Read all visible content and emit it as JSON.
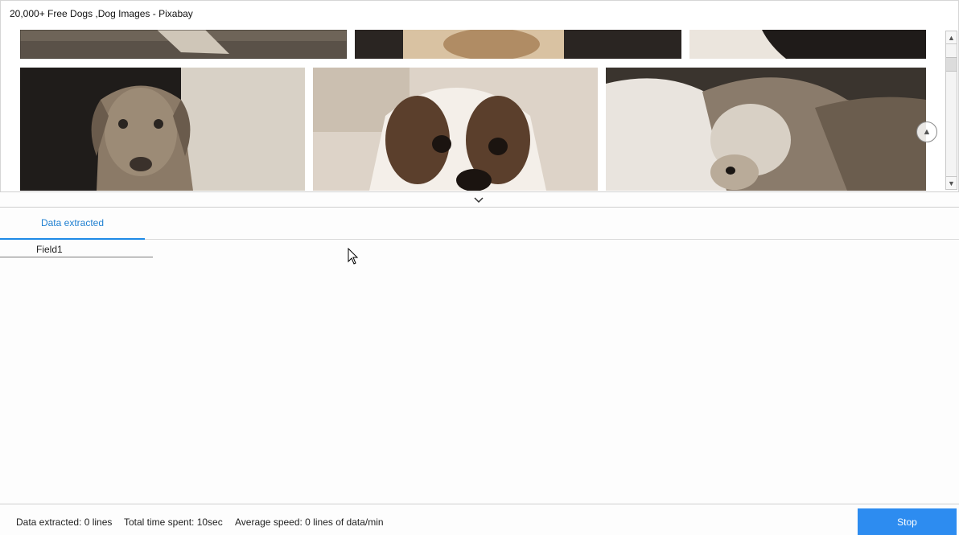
{
  "page": {
    "title": "20,000+ Free Dogs ,Dog Images - Pixabay"
  },
  "scrollbar": {
    "up_glyph": "▲",
    "down_glyph": "▼"
  },
  "back_to_top": {
    "glyph": "▲"
  },
  "tabs": [
    {
      "label": "Data extracted",
      "active": true
    }
  ],
  "table": {
    "columns": [
      "Field1"
    ],
    "rows": []
  },
  "status": {
    "data_extracted": "Data extracted: 0 lines",
    "time_spent": "Total time spent: 10sec",
    "average_speed": "Average speed: 0 lines of data/min"
  },
  "actions": {
    "stop_label": "Stop"
  },
  "colors": {
    "accent": "#2d8cf0",
    "tab_text": "#1e7fd0"
  }
}
